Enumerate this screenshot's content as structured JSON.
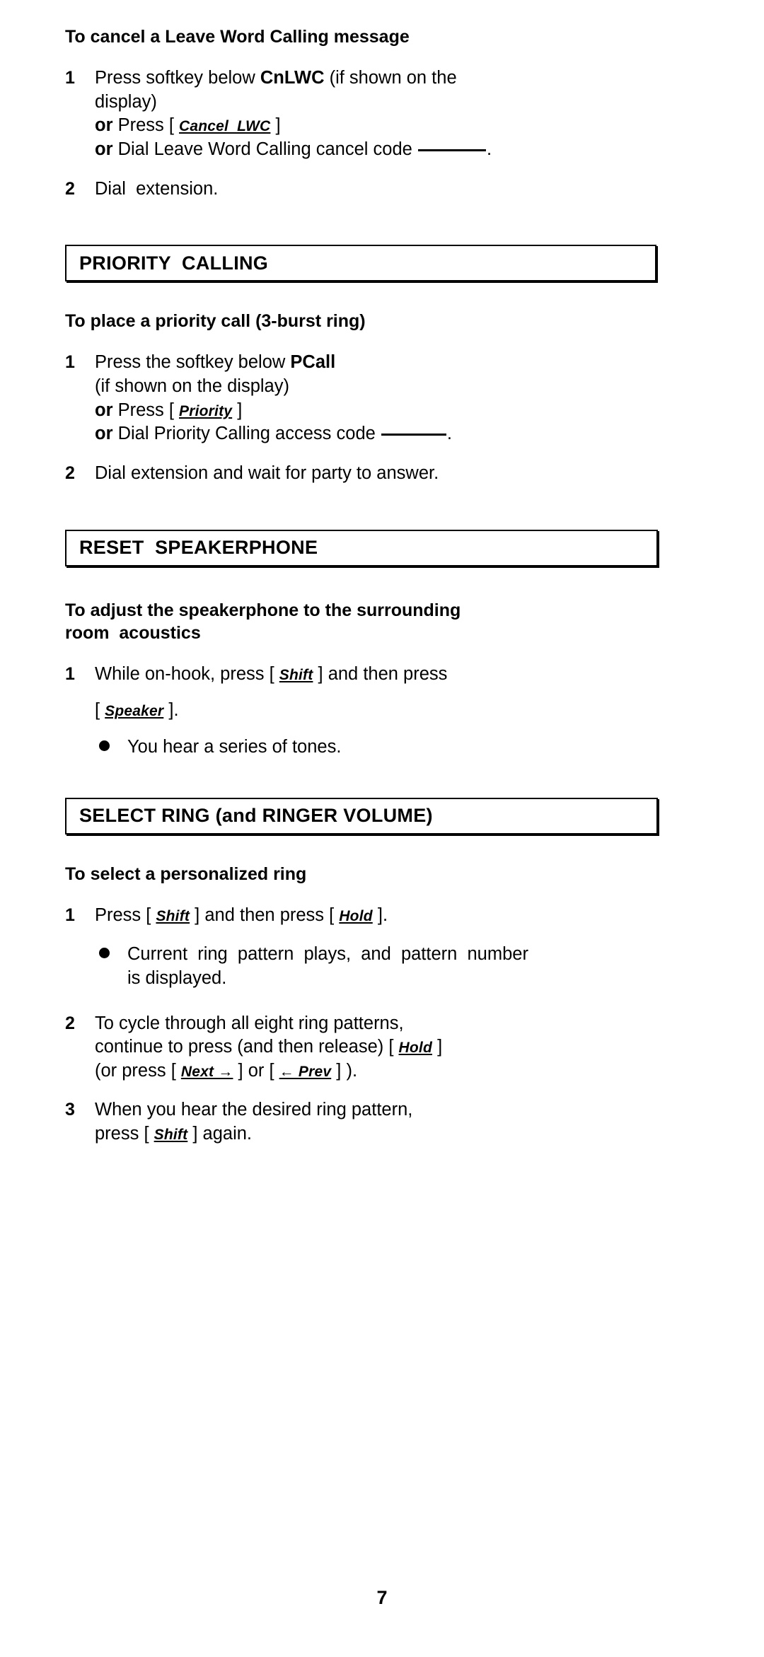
{
  "document": {
    "page_number": "7"
  },
  "sections": [
    {
      "id": "cancel-lwc",
      "heading_box": null,
      "subheading": "To cancel a Leave Word Calling message",
      "steps": [
        {
          "num": "1",
          "lines": [
            {
              "pre": "Press softkey below ",
              "bold": "CnLWC",
              "post": " (if shown on the"
            },
            {
              "pre": "display)"
            },
            {
              "or": "or",
              "pre": " Press [ ",
              "key": "Cancel  LWC",
              "post": " ]"
            },
            {
              "or": "or",
              "pre": " Dial Leave Word Calling cancel code ",
              "blank": true,
              "post": "."
            }
          ]
        },
        {
          "num": "2",
          "lines": [
            {
              "pre": "Dial  extension."
            }
          ]
        }
      ]
    },
    {
      "id": "priority-calling",
      "heading_box": "PRIORITY  CALLING",
      "subheading": "To place a priority call (3-burst ring)",
      "steps": [
        {
          "num": "1",
          "lines": [
            {
              "pre": "Press the softkey below ",
              "bold": "PCall"
            },
            {
              "pre": "(if shown on the display)"
            },
            {
              "or": "or",
              "pre": " Press [ ",
              "key": "Priority",
              "post": " ]"
            },
            {
              "or": "or",
              "pre": " Dial Priority Calling access code ",
              "blank": true,
              "post": "."
            }
          ]
        },
        {
          "num": "2",
          "lines": [
            {
              "pre": "Dial extension and wait for party to answer."
            }
          ]
        }
      ]
    },
    {
      "id": "reset-speakerphone",
      "heading_box": "RESET  SPEAKERPHONE",
      "subheading": "To adjust the speakerphone to the surrounding\nroom  acoustics",
      "steps": [
        {
          "num": "1",
          "lines": [
            {
              "pre": "While on-hook, press [ ",
              "key": "Shift",
              "post": " ] and then press"
            },
            {
              "pre": "[ ",
              "key": "Speaker",
              "post": " ]."
            }
          ],
          "bullets": [
            "You hear a series of tones."
          ]
        }
      ]
    },
    {
      "id": "select-ring",
      "heading_box": "SELECT RING (and RINGER VOLUME)",
      "subheading": "To select a personalized ring",
      "steps": [
        {
          "num": "1",
          "lines": [
            {
              "pre": "Press [ ",
              "key": "Shift",
              "mid": " ] and then press [ ",
              "key2": "Hold",
              "post": " ]."
            }
          ],
          "bullets": [
            "Current  ring  pattern  plays,  and  pattern  number\nis displayed."
          ]
        },
        {
          "num": "2",
          "lines": [
            {
              "pre": "To cycle through all eight ring patterns,"
            },
            {
              "pre": "continue to press (and then release) [ ",
              "key": "Hold",
              "post": " ]"
            },
            {
              "pre": "(or press [ ",
              "key": "Next →",
              "mid": " ] or [ ",
              "key2": "← Prev",
              "post": " ] )."
            }
          ]
        },
        {
          "num": "3",
          "lines": [
            {
              "pre": "When you hear the desired ring pattern,"
            },
            {
              "pre": "press [ ",
              "key": "Shift",
              "post": " ] again."
            }
          ]
        }
      ]
    }
  ]
}
